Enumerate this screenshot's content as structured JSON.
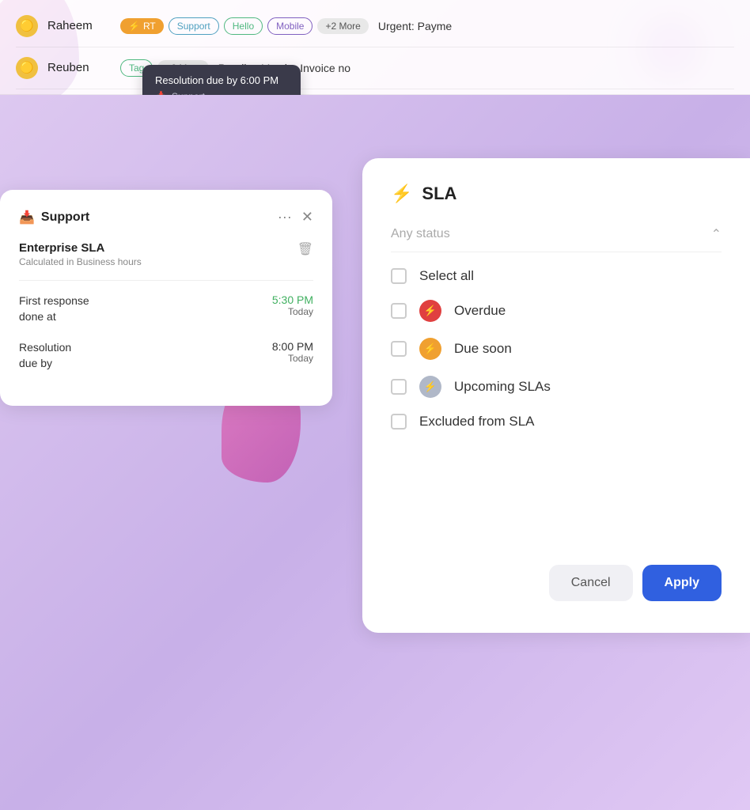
{
  "background": {
    "color": "#f5e8f5"
  },
  "table": {
    "rows": [
      {
        "id": "row-raheem",
        "avatar": "🟡",
        "name": "Raheem",
        "tags": [
          {
            "id": "rt",
            "label": "RT",
            "type": "tag-rt"
          },
          {
            "id": "support",
            "label": "Support",
            "type": "tag-support"
          },
          {
            "id": "hello",
            "label": "Hello",
            "type": "tag-hello"
          },
          {
            "id": "mobile",
            "label": "Mobile",
            "type": "tag-mobile"
          },
          {
            "id": "more",
            "label": "+2 More",
            "type": "tag-more"
          }
        ],
        "subject": "Urgent: Payme"
      },
      {
        "id": "row-reuben",
        "avatar": "🟡",
        "name": "Reuben",
        "tags": [
          {
            "id": "tag",
            "label": "Tag",
            "type": "tag-tag"
          },
          {
            "id": "more2",
            "label": "+2 More",
            "type": "tag-more"
          }
        ],
        "subject": "Pending Vendor Invoice no"
      }
    ]
  },
  "tooltip": {
    "title": "Resolution due by 6:00 PM",
    "sub_icon": "📥",
    "sub_label": "Support"
  },
  "sla_detail_panel": {
    "title": "Support",
    "title_icon": "📥",
    "sla_name": "Enterprise SLA",
    "sla_sub": "Calculated in Business hours",
    "rows": [
      {
        "label": "First response\ndone at",
        "time": "5:30 PM",
        "time_color": "green",
        "date": "Today"
      },
      {
        "label": "Resolution\ndue by",
        "time": "8:00 PM",
        "time_color": "dark",
        "date": "Today"
      }
    ]
  },
  "sla_filter_panel": {
    "title": "SLA",
    "icon": "⚡",
    "status_label": "Any status",
    "options": [
      {
        "id": "select-all",
        "label": "Select all",
        "has_icon": false,
        "checked": false
      },
      {
        "id": "overdue",
        "label": "Overdue",
        "has_icon": true,
        "icon_color": "red",
        "icon": "⚡",
        "checked": false
      },
      {
        "id": "due-soon",
        "label": "Due soon",
        "has_icon": true,
        "icon_color": "orange",
        "icon": "⚡",
        "checked": false
      },
      {
        "id": "upcoming",
        "label": "Upcoming SLAs",
        "has_icon": true,
        "icon_color": "gray",
        "icon": "⚡",
        "checked": false
      },
      {
        "id": "excluded",
        "label": "Excluded from SLA",
        "has_icon": false,
        "checked": false
      }
    ],
    "footer": {
      "cancel_label": "Cancel",
      "apply_label": "Apply"
    }
  }
}
